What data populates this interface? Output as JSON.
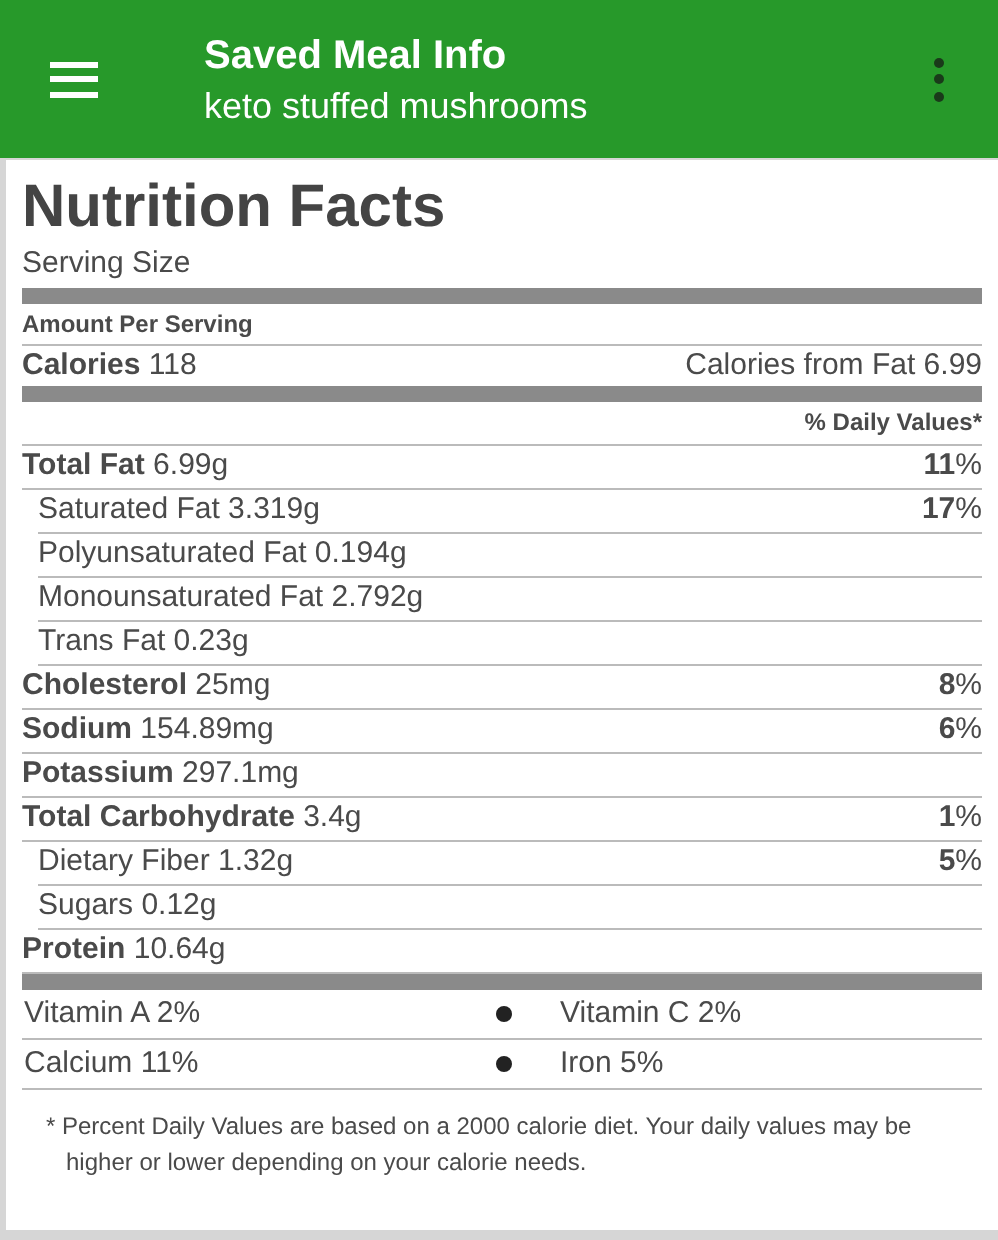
{
  "app_bar": {
    "title": "Saved Meal Info",
    "subtitle": "keto stuffed mushrooms"
  },
  "label": {
    "title": "Nutrition Facts",
    "serving_size": "Serving Size",
    "amount_per_serving": "Amount Per Serving",
    "calories": "**Calories** 118",
    "calories_from_fat": "Calories from Fat 6.99",
    "daily_values_header": "% Daily Values*",
    "nutrients": [
      {
        "kind": "main",
        "text": "**Total Fat** 6.99g",
        "percent": "**11**%"
      },
      {
        "kind": "sub",
        "text": "Saturated Fat 3.319g",
        "percent": "**17**%"
      },
      {
        "kind": "sub",
        "text": "Polyunsaturated Fat 0.194g"
      },
      {
        "kind": "sub",
        "text": "Monounsaturated Fat 2.792g"
      },
      {
        "kind": "sub",
        "text": "Trans Fat 0.23g"
      },
      {
        "kind": "main",
        "text": "**Cholesterol** 25mg",
        "percent": "**8**%"
      },
      {
        "kind": "main",
        "text": "**Sodium** 154.89mg",
        "percent": "**6**%"
      },
      {
        "kind": "main",
        "text": "**Potassium** 297.1mg"
      },
      {
        "kind": "main",
        "text": "**Total Carbohydrate** 3.4g",
        "percent": "**1**%"
      },
      {
        "kind": "sub",
        "text": "Dietary Fiber 1.32g",
        "percent": "**5**%"
      },
      {
        "kind": "sub",
        "text": "Sugars 0.12g"
      },
      {
        "kind": "main",
        "text": "**Protein** 10.64g"
      }
    ],
    "vitamins": [
      [
        "Vitamin A 2%",
        "Vitamin C 2%"
      ],
      [
        "Calcium 11%",
        "Iron 5%"
      ]
    ],
    "footnote": "* Percent Daily Values are based on a 2000 calorie diet. Your daily values may be higher or lower depending on your calorie needs."
  }
}
